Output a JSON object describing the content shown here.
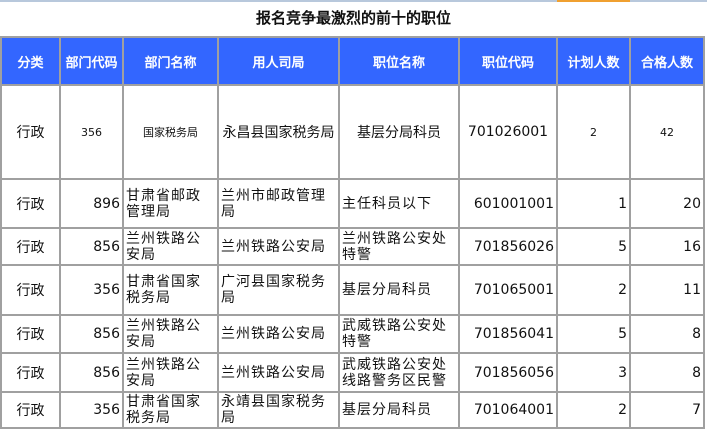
{
  "title": "报名竞争最激烈的前十的职位",
  "headers": [
    "分类",
    "部门代码",
    "部门名称",
    "用人司局",
    "职位名称",
    "职位代码",
    "计划人数",
    "合格人数"
  ],
  "rows": [
    [
      "行政",
      "356",
      "国家税务局",
      "永昌县国家税务局",
      "基层分局科员",
      "701026001",
      "2",
      "42"
    ],
    [
      "行政",
      "896",
      "甘肃省邮政管理局",
      "兰州市邮政管理局",
      "主任科员以下",
      "601001001",
      "1",
      "20"
    ],
    [
      "行政",
      "856",
      "兰州铁路公安局",
      "兰州铁路公安局",
      "兰州铁路公安处特警",
      "701856026",
      "5",
      "16"
    ],
    [
      "行政",
      "356",
      "甘肃省国家税务局",
      "广河县国家税务局",
      "基层分局科员",
      "701065001",
      "2",
      "11"
    ],
    [
      "行政",
      "856",
      "兰州铁路公安局",
      "兰州铁路公安局",
      "武威铁路公安处特警",
      "701856041",
      "5",
      "8"
    ],
    [
      "行政",
      "856",
      "兰州铁路公安局",
      "兰州铁路公安局",
      "武威铁路公安处线路警务区民警",
      "701856056",
      "3",
      "8"
    ],
    [
      "行政",
      "356",
      "甘肃省国家税务局",
      "永靖县国家税务局",
      "基层分局科员",
      "701064001",
      "2",
      "7"
    ]
  ]
}
